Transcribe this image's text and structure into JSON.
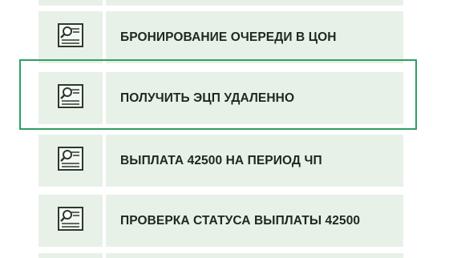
{
  "menu": {
    "items": [
      {
        "label": "БРОНИРОВАНИЕ ОЧЕРЕДИ В ЦОН",
        "icon": "document-magnifier-icon"
      },
      {
        "label": "ПОЛУЧИТЬ ЭЦП УДАЛЕННО",
        "icon": "document-magnifier-icon",
        "highlighted": true
      },
      {
        "label": "ВЫПЛАТА 42500 НА ПЕРИОД ЧП",
        "icon": "document-magnifier-icon"
      },
      {
        "label": "ПРОВЕРКА СТАТУСА ВЫПЛАТЫ 42500",
        "icon": "document-magnifier-icon"
      }
    ]
  },
  "colors": {
    "row_background": "#e8f1e8",
    "highlight_border": "#2f9e63",
    "text": "#1b2a1b",
    "icon_stroke": "#2d3a2d"
  }
}
